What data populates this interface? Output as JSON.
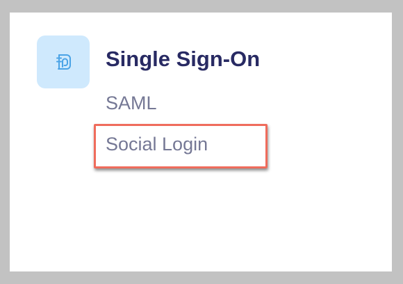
{
  "card": {
    "icon": "sso-loop-icon",
    "title": "Single Sign-On",
    "items": [
      {
        "label": "SAML"
      },
      {
        "label": "Social Login",
        "highlighted": true
      }
    ]
  },
  "colors": {
    "page_background": "#c2c2c2",
    "card_background": "#ffffff",
    "icon_tile": "#cfe9fd",
    "icon_stroke": "#4aa3e6",
    "title": "#282a63",
    "item_text": "#757895",
    "highlight_border": "#ef6c5c"
  }
}
